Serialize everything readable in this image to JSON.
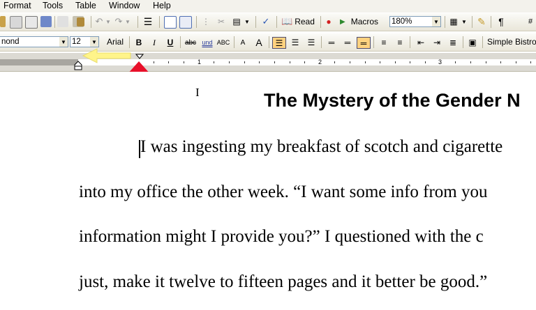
{
  "menu": [
    "Format",
    "Tools",
    "Table",
    "Window",
    "Help"
  ],
  "toolbar1": {
    "read_label": "Read",
    "macros_label": "Macros",
    "zoom_value": "180%",
    "paragraph_mark": "¶"
  },
  "toolbar2": {
    "font_name": "nond",
    "font_size": "12",
    "font_hint": "Arial",
    "bold": "B",
    "italic": "I",
    "underline": "U",
    "strike": "abc",
    "dbl_underline": "und",
    "smallcaps": "ABC",
    "shrink": "A",
    "grow": "A",
    "style_name": "Simple Bistro"
  },
  "ruler": {
    "numbers": [
      "1",
      "2",
      "3"
    ]
  },
  "document": {
    "title": "The Mystery of the Gender N",
    "lines": [
      "I was ingesting my breakfast of scotch and cigarette",
      "into my office the other week.  “I want some info from you",
      "information might I provide you?”  I questioned with the c",
      "just, make it twelve to fifteen pages and it better be good.”"
    ]
  },
  "colors": {
    "highlight": "#ffd27f",
    "arrow_red": "#e8102a",
    "arrow_yellow": "#fff48a"
  }
}
